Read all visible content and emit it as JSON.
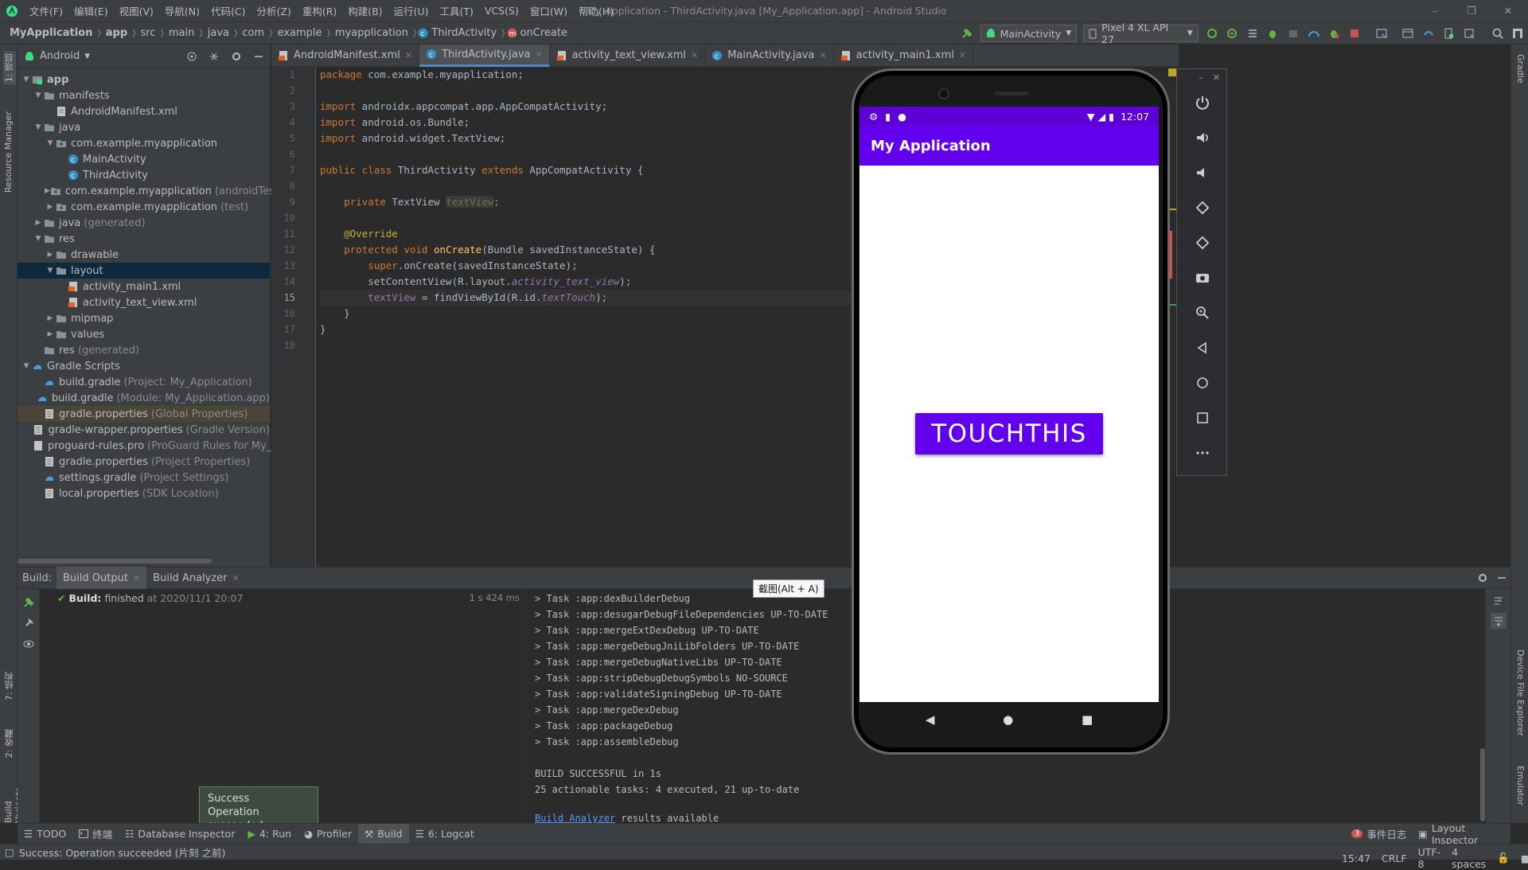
{
  "menubar": {
    "items": [
      "文件(F)",
      "编辑(E)",
      "视图(V)",
      "导航(N)",
      "代码(C)",
      "分析(Z)",
      "重构(R)",
      "构建(B)",
      "运行(U)",
      "工具(T)",
      "VCS(S)",
      "窗口(W)",
      "帮助(H)"
    ],
    "window_title": "My Application - ThirdActivity.java [My_Application.app] - Android Studio"
  },
  "navbar": {
    "breadcrumbs": [
      "MyApplication",
      "app",
      "src",
      "main",
      "java",
      "com",
      "example",
      "myapplication",
      "ThirdActivity",
      "onCreate"
    ],
    "run_config": "MainActivity",
    "device": "Pixel 4 XL API 27"
  },
  "left_strip": {
    "project_label": "1: 项目",
    "resource_manager": "Resource Manager",
    "structure": "7: 结构",
    "favorites": "2: 收藏",
    "build_variants": "Build Variants"
  },
  "right_strip": {
    "gradle": "Gradle",
    "device_file_explorer": "Device File Explorer",
    "emulator": "Emulator"
  },
  "project": {
    "view_mode": "Android",
    "tree": [
      {
        "label": "app",
        "dim": "",
        "bold": true
      },
      {
        "label": "manifests",
        "dim": ""
      },
      {
        "label": "AndroidManifest.xml",
        "dim": ""
      },
      {
        "label": "java",
        "dim": ""
      },
      {
        "label": "com.example.myapplication",
        "dim": ""
      },
      {
        "label": "MainActivity",
        "dim": ""
      },
      {
        "label": "ThirdActivity",
        "dim": ""
      },
      {
        "label": "com.example.myapplication",
        "dim": "(androidTest)"
      },
      {
        "label": "com.example.myapplication",
        "dim": "(test)"
      },
      {
        "label": "java",
        "dim": "(generated)"
      },
      {
        "label": "res",
        "dim": ""
      },
      {
        "label": "drawable",
        "dim": ""
      },
      {
        "label": "layout",
        "dim": ""
      },
      {
        "label": "activity_main1.xml",
        "dim": ""
      },
      {
        "label": "activity_text_view.xml",
        "dim": ""
      },
      {
        "label": "mipmap",
        "dim": ""
      },
      {
        "label": "values",
        "dim": ""
      },
      {
        "label": "res",
        "dim": "(generated)"
      },
      {
        "label": "Gradle Scripts",
        "dim": ""
      },
      {
        "label": "build.gradle",
        "dim": "(Project: My_Application)"
      },
      {
        "label": "build.gradle",
        "dim": "(Module: My_Application.app)"
      },
      {
        "label": "gradle.properties",
        "dim": "(Global Properties)"
      },
      {
        "label": "gradle-wrapper.properties",
        "dim": "(Gradle Version)"
      },
      {
        "label": "proguard-rules.pro",
        "dim": "(ProGuard Rules for My_A"
      },
      {
        "label": "gradle.properties",
        "dim": "(Project Properties)"
      },
      {
        "label": "settings.gradle",
        "dim": "(Project Settings)"
      },
      {
        "label": "local.properties",
        "dim": "(SDK Location)"
      }
    ]
  },
  "editor": {
    "tabs": [
      "AndroidManifest.xml",
      "ThirdActivity.java",
      "activity_text_view.xml",
      "MainActivity.java",
      "activity_main1.xml"
    ],
    "active_tab": "ThirdActivity.java",
    "line_numbers": [
      "1",
      "2",
      "3",
      "4",
      "5",
      "6",
      "7",
      "8",
      "9",
      "10",
      "11",
      "12",
      "13",
      "14",
      "15",
      "16",
      "17",
      "18"
    ],
    "code": {
      "l1_kw": "package",
      "l1_rest": " com.example.myapplication;",
      "l3_kw": "import",
      "l3_rest": " androidx.appcompat.app.AppCompatActivity;",
      "l4_kw": "import",
      "l4_rest": " android.os.Bundle;",
      "l5_kw": "import",
      "l5_rest": " android.widget.TextView;",
      "l7_kw1": "public class",
      "l7_name": " ThirdActivity ",
      "l7_kw2": "extends",
      "l7_rest": " AppCompatActivity {",
      "l9_kw": "    private",
      "l9_type": " TextView ",
      "l9_field": "textView",
      "l9_semi": ";",
      "l11_ann": "    @Override",
      "l12_kw": "    protected void",
      "l12_fn": " onCreate",
      "l12_rest": "(Bundle savedInstanceState) {",
      "l13_kw": "        super",
      "l13_rest": ".onCreate(savedInstanceState);",
      "l14_a": "        setContentView(R.layout.",
      "l14_it": "activity_text_view",
      "l14_b": ");",
      "l15_f": "        textView",
      "l15_a": " = findViewById(R.id.",
      "l15_it": "textTouch",
      "l15_b": ");",
      "l16": "    }",
      "l17": "}"
    }
  },
  "build": {
    "label": "Build:",
    "tabs": [
      "Build Output",
      "Build Analyzer"
    ],
    "status_bold": "Build:",
    "status_text": "finished",
    "status_time": "at 2020/11/1 20:07",
    "duration": "1 s 424 ms",
    "output": [
      "> Task :app:dexBuilderDebug",
      "> Task :app:desugarDebugFileDependencies UP-TO-DATE",
      "> Task :app:mergeExtDexDebug UP-TO-DATE",
      "> Task :app:mergeDebugJniLibFolders UP-TO-DATE",
      "> Task :app:mergeDebugNativeLibs UP-TO-DATE",
      "> Task :app:stripDebugDebugSymbols NO-SOURCE",
      "> Task :app:validateSigningDebug UP-TO-DATE",
      "> Task :app:mergeDexDebug",
      "> Task :app:packageDebug",
      "> Task :app:assembleDebug",
      "",
      "BUILD SUCCESSFUL in 1s",
      "25 actionable tasks: 4 executed, 21 up-to-date",
      ""
    ],
    "analyzer_link": "Build Analyzer",
    "analyzer_rest": " results available",
    "tooltip": "截图(Alt + A)"
  },
  "balloon": {
    "title": "Success",
    "text": "Operation succeeded"
  },
  "toolwindows": {
    "todo": "TODO",
    "terminal": "终端",
    "database": "Database Inspector",
    "run": "4: Run",
    "profiler": "Profiler",
    "build": "Build",
    "logcat": "6: Logcat",
    "event_count": "3",
    "event_log": "事件日志",
    "layout_inspector": "Layout Inspector"
  },
  "statusbar": {
    "message": "Success: Operation succeeded (片刻 之前)",
    "position": "15:47",
    "line_sep": "CRLF",
    "encoding": "UTF-8",
    "indent": "4 spaces"
  },
  "emulator": {
    "time": "12:07",
    "app_title": "My Application",
    "button_text": "TOUCHTHIS"
  },
  "colors": {
    "accent": "#6200ee",
    "status_purple": "#5d00d6",
    "selection": "#0d293e"
  }
}
